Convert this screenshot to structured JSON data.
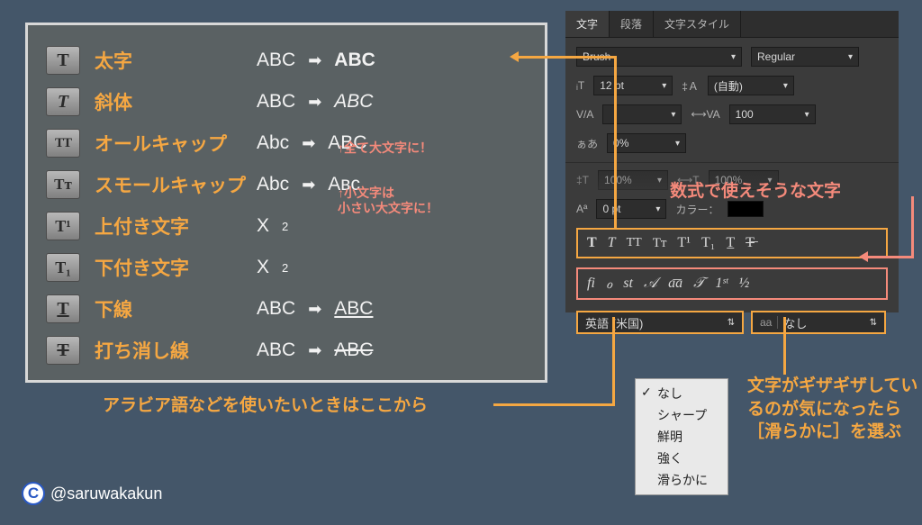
{
  "rows": [
    {
      "icon": "T",
      "iconStyle": "font-weight:bold;font-size:20px",
      "label": "太字",
      "before": "ABC",
      "after": "ABC",
      "afterStyle": "font-weight:bold"
    },
    {
      "icon": "T",
      "iconStyle": "font-style:italic;font-size:20px",
      "label": "斜体",
      "before": "ABC",
      "after": "ABC",
      "afterStyle": "font-style:italic"
    },
    {
      "icon": "TT",
      "iconStyle": "font-size:15px;letter-spacing:-1px",
      "label": "オールキャップ",
      "before": "Abc",
      "after": "ABC"
    },
    {
      "icon": "Tᴛ",
      "iconStyle": "font-size:17px",
      "label": "スモールキャップ",
      "before": "Abc",
      "after": "Aʙᴄ"
    },
    {
      "icon": "T¹",
      "iconStyle": "font-size:18px",
      "label": "上付き文字",
      "beforeRaw": "X<span class='sup'>2</span>"
    },
    {
      "icon": "T₁",
      "iconStyle": "font-size:18px",
      "label": "下付き文字",
      "beforeRaw": "X<span class='sub'>2</span>"
    },
    {
      "icon": "T",
      "iconStyle": "font-size:20px;text-decoration:underline",
      "label": "下線",
      "before": "ABC",
      "after": "ABC",
      "afterStyle": "text-decoration:underline"
    },
    {
      "icon": "T",
      "iconStyle": "font-size:20px;text-decoration:line-through",
      "label": "打ち消し線",
      "before": "ABC",
      "after": "ABC",
      "afterStyle": "text-decoration:line-through"
    }
  ],
  "notes": {
    "allcaps": "↑全て大文字に！",
    "smallcaps_line1": "↑小文字は",
    "smallcaps_line2": "小さい大文字に！"
  },
  "panel": {
    "tabs": [
      "文字",
      "段落",
      "文字スタイル"
    ],
    "font_family": "Brush",
    "font_style": "Regular",
    "font_size": "12 pt",
    "leading": "(自動)",
    "tracking": "100",
    "tsume": "0%",
    "vscale": "100%",
    "hscale": "100%",
    "baseline": "0 pt",
    "color_label": "カラー：",
    "toolbar1": [
      "T",
      "T",
      "TT",
      "Tᴛ",
      "T¹",
      "T₁",
      "T̲",
      "T̶"
    ],
    "toolbar2": [
      "fi",
      "ℴ",
      "st",
      "𝒜",
      "a͞a",
      "𝒯",
      "1ˢᵗ",
      "½"
    ],
    "language": "英語 (米国)",
    "aa_prefix": "aa",
    "antialias": "なし"
  },
  "callouts": {
    "formula": "数式で使えそうな文字",
    "arabic": "アラビア語などを使いたいときはここから",
    "smooth": "文字がギザギザしているのが気になったら［滑らかに］を選ぶ"
  },
  "menu": [
    "なし",
    "シャープ",
    "鮮明",
    "強く",
    "滑らかに"
  ],
  "credit": {
    "badge": "C",
    "handle": "@saruwakakun"
  }
}
